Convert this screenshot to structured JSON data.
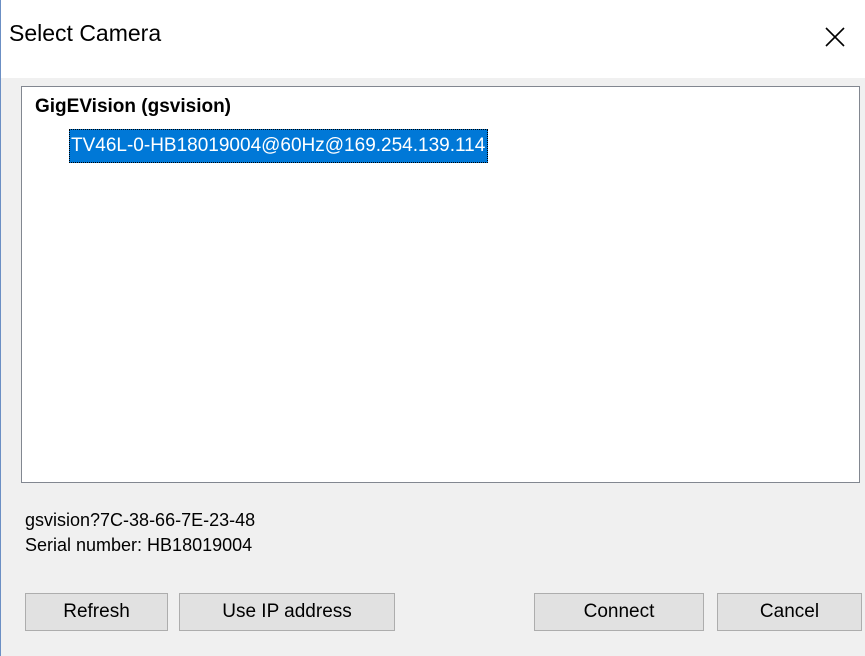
{
  "window": {
    "title": "Select Camera",
    "close_icon": "close-icon"
  },
  "camera_list": {
    "group_label": "GigEVision (gsvision)",
    "items": [
      {
        "label": "TV46L-0-HB18019004@60Hz@169.254.139.114",
        "selected": true
      }
    ]
  },
  "details": {
    "device_id": "gsvision?7C-38-66-7E-23-48",
    "serial": "Serial number: HB18019004"
  },
  "buttons": {
    "refresh": "Refresh",
    "use_ip": "Use IP address",
    "connect": "Connect",
    "cancel": "Cancel"
  },
  "colors": {
    "selection": "#0078d7",
    "dialog_bg": "#f0f0f0",
    "button_bg": "#e1e1e1"
  }
}
